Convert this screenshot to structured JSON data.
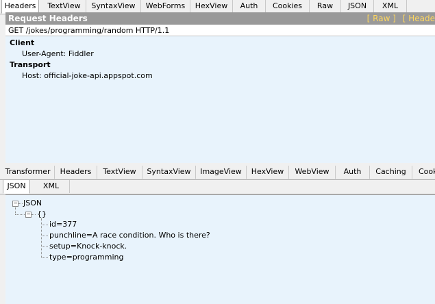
{
  "request_tabs": [
    "Headers",
    "TextView",
    "SyntaxView",
    "WebForms",
    "HexView",
    "Auth",
    "Cookies",
    "Raw",
    "JSON",
    "XML"
  ],
  "request_headers": {
    "title": "Request Headers",
    "raw_link": "[ Raw ]",
    "header_defs_link": "[ Heade",
    "request_line": "GET /jokes/programming/random HTTP/1.1",
    "groups": [
      {
        "name": "Client",
        "lines": [
          "User-Agent: Fiddler"
        ]
      },
      {
        "name": "Transport",
        "lines": [
          "Host: official-joke-api.appspot.com"
        ]
      }
    ]
  },
  "response_tabs": [
    "Transformer",
    "Headers",
    "TextView",
    "SyntaxView",
    "ImageView",
    "HexView",
    "WebView",
    "Auth",
    "Caching",
    "Cook"
  ],
  "response_subtabs": [
    "JSON",
    "XML"
  ],
  "json_tree": {
    "root": "JSON",
    "object": "{}",
    "items": [
      "id=377",
      "punchline=A race condition. Who is there?",
      "setup=Knock-knock.",
      "type=programming"
    ]
  }
}
